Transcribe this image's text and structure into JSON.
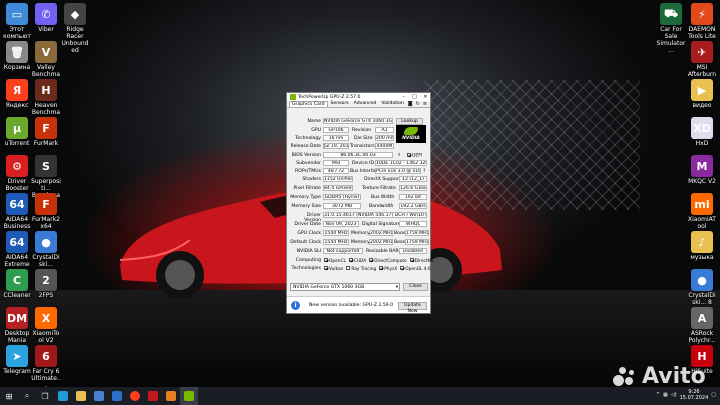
{
  "desktop": {
    "left_icons": [
      {
        "label": "Этот компьютер",
        "icon": "computer-icon",
        "color": "#3d8bd9",
        "glyph": "▭"
      },
      {
        "label": "Viber",
        "icon": "viber-icon",
        "color": "#7360f2",
        "glyph": "✆"
      },
      {
        "label": "Ridge Racer Unbounded",
        "icon": "ridge-racer-icon",
        "color": "#444",
        "glyph": "◆"
      },
      {
        "label": "Корзина",
        "icon": "trash-icon",
        "color": "#888",
        "glyph": "🗑"
      },
      {
        "label": "Valley Benchma...",
        "icon": "valley-icon",
        "color": "#8a6a3a",
        "glyph": "V"
      },
      {
        "label": "Яндекс",
        "icon": "yandex-icon",
        "color": "#fc3f1d",
        "glyph": "Я"
      },
      {
        "label": "Heaven Benchma...",
        "icon": "heaven-icon",
        "color": "#6b2a1a",
        "glyph": "H"
      },
      {
        "label": "uTorrent",
        "icon": "utorrent-icon",
        "color": "#6aa92e",
        "glyph": "µ"
      },
      {
        "label": "FurMark",
        "icon": "furmark-icon",
        "color": "#c8320a",
        "glyph": "F"
      },
      {
        "label": "Driver Booster",
        "icon": "driver-booster-icon",
        "color": "#d92020",
        "glyph": "⚙"
      },
      {
        "label": "Superpositi... Benchmark",
        "icon": "superposition-icon",
        "color": "#333",
        "glyph": "S"
      },
      {
        "label": "AIDA64 Business",
        "icon": "aida64-icon",
        "color": "#1e5bb8",
        "glyph": "64"
      },
      {
        "label": "FurMark2 x64",
        "icon": "furmark2-icon",
        "color": "#c8320a",
        "glyph": "F"
      },
      {
        "label": "AIDA64 Extreme",
        "icon": "aida64-extreme-icon",
        "color": "#1e5bb8",
        "glyph": "64"
      },
      {
        "label": "CrystalDiski...",
        "icon": "crystaldisk-icon",
        "color": "#3a7bd5",
        "glyph": "●"
      },
      {
        "label": "CCleaner",
        "icon": "ccleaner-icon",
        "color": "#2e9e4e",
        "glyph": "C"
      },
      {
        "label": "2FPS",
        "icon": "fps-icon",
        "color": "#555",
        "glyph": "2"
      },
      {
        "label": "Desktop Mania",
        "icon": "desktop-mania-icon",
        "color": "#b52020",
        "glyph": "DM"
      },
      {
        "label": "XiaomiTool V2",
        "icon": "xiaomitool-icon",
        "color": "#ff6900",
        "glyph": "X"
      },
      {
        "label": "Telegram",
        "icon": "telegram-icon",
        "color": "#2aa3df",
        "glyph": "➤"
      },
      {
        "label": "Far Cry 6 Ultimate...",
        "icon": "farcry-icon",
        "color": "#a01818",
        "glyph": "6"
      }
    ],
    "right_icons": [
      {
        "label": "Car For Sale Simulator...",
        "icon": "car-sale-icon",
        "color": "#1c6b3a",
        "glyph": "⛟"
      },
      {
        "label": "DAEMON Tools Lite",
        "icon": "daemon-tools-icon",
        "color": "#e14b1c",
        "glyph": "⚡"
      },
      {
        "label": "MSI Afterburner",
        "icon": "afterburner-icon",
        "color": "#a81c1c",
        "glyph": "✈"
      },
      {
        "label": "видео",
        "icon": "video-folder-icon",
        "color": "#e8c150",
        "glyph": "▶"
      },
      {
        "label": "HxD",
        "icon": "hxd-icon",
        "color": "#dde",
        "glyph": "XD"
      },
      {
        "label": "MKQC V2",
        "icon": "mkqc-icon",
        "color": "#8a2a9e",
        "glyph": "M"
      },
      {
        "label": "XiaomiATool",
        "icon": "xiaomiatool-icon",
        "color": "#ff6900",
        "glyph": "mi"
      },
      {
        "label": "музыка",
        "icon": "music-folder-icon",
        "color": "#e8c150",
        "glyph": "♪"
      },
      {
        "label": "CrystalDiski... 8",
        "icon": "crystaldisk8-icon",
        "color": "#3a7bd5",
        "glyph": "●"
      },
      {
        "label": "ASRock Polychr...",
        "icon": "asrock-icon",
        "color": "#666",
        "glyph": "A"
      },
      {
        "label": "HiSuite",
        "icon": "hisuite-icon",
        "color": "#c7000b",
        "glyph": "H"
      }
    ]
  },
  "gpuz": {
    "title": "TechPowerUp GPU-Z 2.57.0",
    "window_buttons": [
      "–",
      "□",
      "✕"
    ],
    "tabs": [
      "Graphics Card",
      "Sensors",
      "Advanced",
      "Validation"
    ],
    "name_label": "Name",
    "name_value": "NVIDIA GeForce GTX 1060 3GB",
    "lookup": "Lookup",
    "gpu_label": "GPU",
    "gpu_value": "GP106",
    "revision_label": "Revision",
    "revision_value": "A1",
    "technology_label": "Technology",
    "technology_value": "16 nm",
    "diesize_label": "Die Size",
    "diesize_value": "200 mm²",
    "release_label": "Release Date",
    "release_value": "Jul 19, 2016",
    "transistors_label": "Transistors",
    "transistors_value": "4400M",
    "bios_label": "BIOS Version",
    "bios_value": "86.06.3C.00.03",
    "uefi": "UEFI",
    "subvendor_label": "Subvendor",
    "subvendor_value": "MSI",
    "deviceid_label": "Device ID",
    "deviceid_value": "10DE 1C02 - 1462 3287",
    "rops_label": "ROPs/TMUs",
    "rops_value": "48 / 72",
    "bus_label": "Bus Interface",
    "bus_value": "PCIe x16 3.0 @ x16 3.0",
    "shaders_label": "Shaders",
    "shaders_value": "1152 Unified",
    "directx_label": "DirectX Support",
    "directx_value": "12 (12_1)",
    "pixel_label": "Pixel Fillrate",
    "pixel_value": "84.4 GPixel/s",
    "texture_label": "Texture Fillrate",
    "texture_value": "126.6 GTexel/s",
    "memtype_label": "Memory Type",
    "memtype_value": "GDDR5 (Hynix)",
    "buswidth_label": "Bus Width",
    "buswidth_value": "192 bit",
    "memsize_label": "Memory Size",
    "memsize_value": "3072 MB",
    "bandwidth_label": "Bandwidth",
    "bandwidth_value": "192.2 GB/s",
    "driver_label": "Driver Version",
    "driver_value": "31.0.15.4617 (NVIDIA 546.17) DCH / Win10 64",
    "driverdate_label": "Driver Date",
    "driverdate_value": "Nov 09, 2023",
    "digsig_label": "Digital Signature",
    "digsig_value": "WHQL",
    "gpuclock_label": "GPU Clock",
    "gpuclock_value": "1544 MHz",
    "mem_label": "Memory",
    "mem1_value": "2002 MHz",
    "boost_label": "Boost",
    "boost1_value": "1759 MHz",
    "defclock_label": "Default Clock",
    "defclock_value": "1544 MHz",
    "mem2_value": "2002 MHz",
    "boost2_value": "1759 MHz",
    "sli_label": "NVIDIA SLI",
    "sli_value": "Not supported",
    "rebar_label": "Resizable BAR",
    "rebar_value": "Disabled",
    "computing_label": "Computing",
    "computing": [
      {
        "name": "OpenCL",
        "on": true
      },
      {
        "name": "CUDA",
        "on": true
      },
      {
        "name": "DirectCompute",
        "on": true
      },
      {
        "name": "DirectML",
        "on": true
      }
    ],
    "technologies_label": "Technologies",
    "technologies": [
      {
        "name": "Vulkan",
        "on": true
      },
      {
        "name": "Ray Tracing",
        "on": false
      },
      {
        "name": "PhysX",
        "on": true
      },
      {
        "name": "OpenGL 4.6",
        "on": true
      }
    ],
    "selected_gpu": "NVIDIA GeForce GTX 1060 3GB",
    "close": "Close",
    "update_msg": "New version available: GPU-Z 2.59.0",
    "update_btn": "Update Now",
    "logo_text": "NVIDIA"
  },
  "taskbar": {
    "time": "9:26",
    "date": "15.07.2024"
  },
  "watermark": "Avito"
}
